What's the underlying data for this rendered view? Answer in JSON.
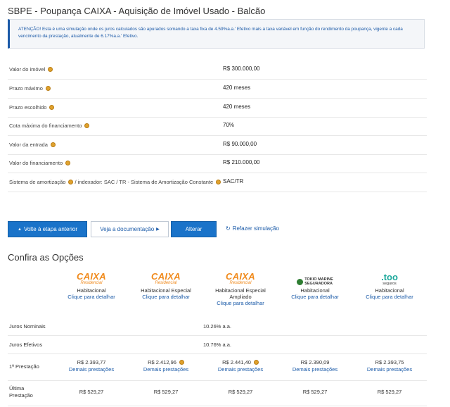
{
  "page_title": "SBPE - Poupança CAIXA - Aquisição de Imóvel Usado - Balcão",
  "alert_text": "ATENÇÃO! Esta é uma simulação onde os juros calculados são apurados somando a taxa fixa de 4.59%a.a.' Efetivo mais a taxa variável em função do rendimento da poupança, vigente a cada vencimento da prestação, atualmente de 6.17%a.a.' Efetivo.",
  "summary": [
    {
      "label": "Valor do imóvel",
      "value": "R$ 300.000,00"
    },
    {
      "label": "Prazo máximo",
      "value": "420 meses"
    },
    {
      "label": "Prazo escolhido",
      "value": "420 meses"
    },
    {
      "label": "Cota máxima do financiamento",
      "value": "70%"
    },
    {
      "label": "Valor da entrada",
      "value": "R$ 90.000,00"
    },
    {
      "label": "Valor do financiamento",
      "value": "R$ 210.000,00"
    },
    {
      "label": "Sistema de amortização",
      "label2": "/ indexador: SAC / TR - Sistema de Amortização Constante",
      "value": "SAC/TR"
    }
  ],
  "buttons": {
    "back": "Volte à etapa anterior",
    "docs": "Veja a documentação",
    "change": "Alterar",
    "redo": "Refazer simulação"
  },
  "options_title": "Confira as Opções",
  "options": [
    {
      "brand": "CAIXA",
      "brand_sub": "Residencial",
      "type": "Habitacional",
      "type2": "",
      "link": "Clique para detalhar"
    },
    {
      "brand": "CAIXA",
      "brand_sub": "Residencial",
      "type": "Habitacional Especial",
      "type2": "",
      "link": "Clique para detalhar"
    },
    {
      "brand": "CAIXA",
      "brand_sub": "Residencial",
      "type": "Habitacional Especial",
      "type2": "Ampliado",
      "link": "Clique para detalhar"
    },
    {
      "brand": "TOKIO MARINE",
      "brand_sub": "SEGURADORA",
      "type": "Habitacional",
      "type2": "",
      "link": "Clique para detalhar"
    },
    {
      "brand": ".too",
      "brand_sub": "seguros",
      "type": "Habitacional",
      "type2": "",
      "link": "Clique para detalhar"
    }
  ],
  "table": {
    "juros_nominais_label": "Juros Nominais",
    "juros_nominais_value": "10.26% a.a.",
    "juros_efetivos_label": "Juros Efetivos",
    "juros_efetivos_value": "10.76% a.a.",
    "primeira_label": "1ª Prestação",
    "primeira": [
      "R$ 2.393,77",
      "R$ 2.412,96",
      "R$ 2.441,40",
      "R$ 2.390,09",
      "R$ 2.393,75"
    ],
    "demais_link": "Demais prestações",
    "ultima_label_1": "Última",
    "ultima_label_2": "Prestação",
    "ultima": [
      "R$ 529,27",
      "R$ 529,27",
      "R$ 529,27",
      "R$ 529,27",
      "R$ 529,27"
    ]
  },
  "colors": {
    "primary": "#1a73c9",
    "link": "#1a5aa8",
    "caixa_blue": "#1b5da8",
    "caixa_orange": "#f08a1c",
    "coin": "#e0a22e"
  }
}
